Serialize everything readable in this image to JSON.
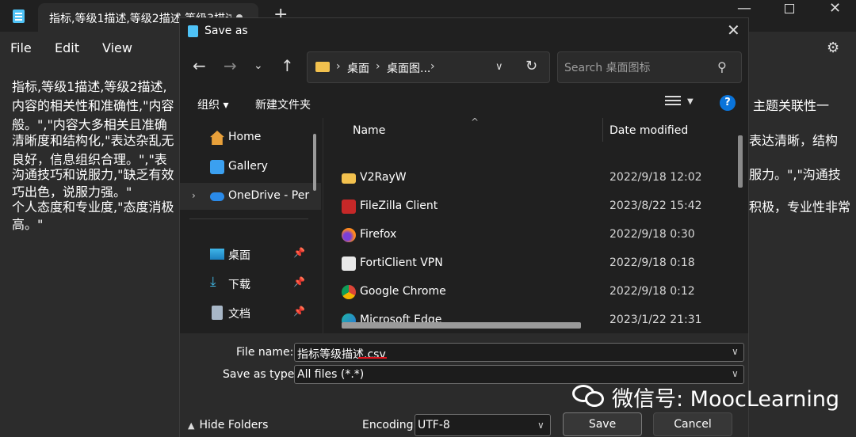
{
  "notepad": {
    "tab_title": "指标,等级1描述,等级2描述,等级3描述",
    "menu": [
      "File",
      "Edit",
      "View"
    ],
    "editor_lines_left": [
      "指标,等级1描述,等级2描述,",
      "内容的相关性和准确性,\"内容",
      "般。\",\"内容大多相关且准确",
      "清晰度和结构化,\"表达杂乱无",
      "良好，信息组织合理。\",\"表",
      "沟通技巧和说服力,\"缺乏有效",
      "巧出色，说服力强。\"",
      "个人态度和专业度,\"态度消极",
      "高。\""
    ],
    "editor_lines_right": [
      "主题关联性一",
      "表达清晰，结构",
      "服力。\",\"沟通技",
      "积极，专业性非常"
    ]
  },
  "dialog": {
    "title": "Save as",
    "address": {
      "segment1": "桌面",
      "segment2": "桌面图..."
    },
    "search": {
      "placeholder": "Search 桌面图标"
    },
    "commands": {
      "organize": "组织 ▾",
      "new_folder": "新建文件夹",
      "help": "?"
    },
    "sidebar": {
      "items": [
        {
          "label": "Home",
          "icon": "home-icon"
        },
        {
          "label": "Gallery",
          "icon": "gallery-icon"
        },
        {
          "label": "OneDrive - Per",
          "icon": "onedrive-icon"
        },
        {
          "label": "桌面",
          "icon": "desktop-icon"
        },
        {
          "label": "下载",
          "icon": "download-icon"
        },
        {
          "label": "文档",
          "icon": "documents-icon"
        }
      ]
    },
    "file_list": {
      "columns": [
        "Name",
        "Date modified"
      ],
      "rows": [
        {
          "name": "V2RayW",
          "date": "2022/9/18 12:02",
          "icon": "folder-icon"
        },
        {
          "name": "FileZilla Client",
          "date": "2023/8/22 15:42",
          "icon": "filezilla-icon"
        },
        {
          "name": "Firefox",
          "date": "2022/9/18 0:30",
          "icon": "firefox-icon"
        },
        {
          "name": "FortiClient VPN",
          "date": "2022/9/18 0:18",
          "icon": "forticlient-icon"
        },
        {
          "name": "Google Chrome",
          "date": "2022/9/18 0:12",
          "icon": "chrome-icon"
        },
        {
          "name": "Microsoft Edge",
          "date": "2023/1/22 21:31",
          "icon": "edge-icon"
        }
      ]
    },
    "file_name_label": "File name:",
    "file_name_value": "指标等级描述.csv",
    "save_type_label": "Save as type:",
    "save_type_value": "All files  (*.*)",
    "hide_folders": "Hide Folders",
    "encoding_label": "Encoding:",
    "encoding_value": "UTF-8",
    "save_button": "Save",
    "cancel_button": "Cancel"
  },
  "watermark": {
    "text": "微信号: MoocLearning"
  },
  "colors": {
    "background": "#202020",
    "editor": "#2c2c2c",
    "accent": "#0a74da",
    "underline": "#e0141e"
  }
}
